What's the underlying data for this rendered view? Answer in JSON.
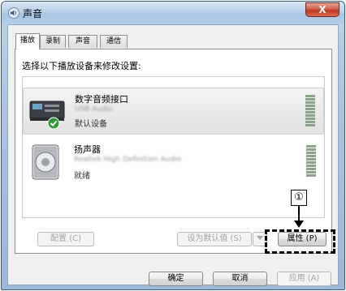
{
  "window": {
    "title": "声音",
    "close_label": "X"
  },
  "tabs": [
    {
      "label": "播放",
      "active": true
    },
    {
      "label": "录制",
      "active": false
    },
    {
      "label": "声音",
      "active": false
    },
    {
      "label": "通信",
      "active": false
    }
  ],
  "instruction": "选择以下播放设备来修改设置:",
  "devices": [
    {
      "name": "数字音频接口",
      "driver": "USB Audio",
      "status": "默认设备",
      "icon": "digital-interface-icon",
      "selected": true
    },
    {
      "name": "扬声器",
      "driver": "Realtek High Definition Audio",
      "status": "就绪",
      "icon": "speaker-icon",
      "selected": false
    }
  ],
  "panel_buttons": {
    "configure": "配置 (C)",
    "set_default": "设为默认值 (S)",
    "properties": "属性 (P)"
  },
  "dialog_buttons": {
    "ok": "确定",
    "cancel": "取消",
    "apply": "应用 (A)"
  },
  "annotation": {
    "marker": "①"
  }
}
